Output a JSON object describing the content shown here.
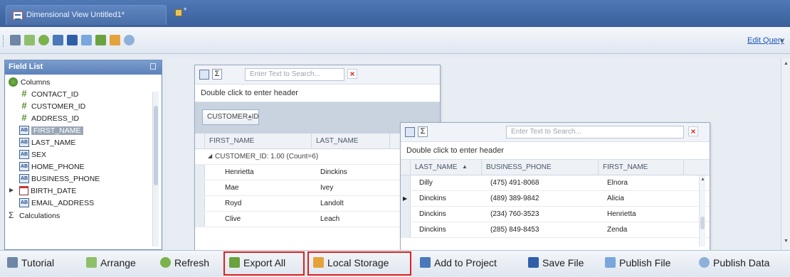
{
  "window": {
    "tab_title": "Dimensional View Untitled1*",
    "new_tab_symbol": "*"
  },
  "toolbar": {
    "edit_query_label": "Edit Query",
    "more_symbol": "▾"
  },
  "field_list": {
    "title": "Field List",
    "columns_label": "Columns",
    "fields": [
      {
        "label": "CONTACT_ID",
        "type": "numeric",
        "icon": "hash-icon"
      },
      {
        "label": "CUSTOMER_ID",
        "type": "numeric",
        "icon": "hash-icon"
      },
      {
        "label": "ADDRESS_ID",
        "type": "numeric",
        "icon": "hash-icon"
      },
      {
        "label": "FIRST_NAME",
        "type": "text",
        "icon": "text-field-icon",
        "selected": true
      },
      {
        "label": "LAST_NAME",
        "type": "text",
        "icon": "text-field-icon"
      },
      {
        "label": "SEX",
        "type": "text",
        "icon": "text-field-icon"
      },
      {
        "label": "HOME_PHONE",
        "type": "text",
        "icon": "text-field-icon"
      },
      {
        "label": "BUSINESS_PHONE",
        "type": "text",
        "icon": "text-field-icon"
      },
      {
        "label": "BIRTH_DATE",
        "type": "date",
        "icon": "calendar-icon"
      },
      {
        "label": "EMAIL_ADDRESS",
        "type": "text",
        "icon": "text-field-icon"
      }
    ],
    "calculations_label": "Calculations"
  },
  "grid1": {
    "search_placeholder": "Enter Text to Search...",
    "header_hint": "Double click to enter header",
    "group_by": "CUSTOMER_ID",
    "columns": [
      "FIRST_NAME",
      "LAST_NAME"
    ],
    "group_row": "CUSTOMER_ID: 1.00 (Count=6)",
    "rows": [
      [
        "Henrietta",
        "Dinckins"
      ],
      [
        "Mae",
        "Ivey"
      ],
      [
        "Royd",
        "Landolt"
      ],
      [
        "Clive",
        "Leach"
      ]
    ]
  },
  "grid2": {
    "search_placeholder": "Enter Text to Search...",
    "header_hint": "Double click to enter header",
    "columns": [
      "LAST_NAME",
      "BUSINESS_PHONE",
      "FIRST_NAME"
    ],
    "rows": [
      [
        "Dilly",
        "(475) 491-8068",
        "Elnora"
      ],
      [
        "Dinckins",
        "(489) 389-9842",
        "Alicia"
      ],
      [
        "Dinckins",
        "(234) 760-3523",
        "Henrietta"
      ],
      [
        "Dinckins",
        "(285) 849-8453",
        "Zenda"
      ]
    ]
  },
  "bottom_bar": {
    "tutorial": "Tutorial",
    "arrange": "Arrange",
    "refresh": "Refresh",
    "export_all": "Export All",
    "local_storage": "Local Storage",
    "add_to_project": "Add to Project",
    "save_file": "Save File",
    "publish_file": "Publish File",
    "publish_data": "Publish Data"
  },
  "colors": {
    "title_bar": "#3f66a3",
    "highlight": "#e0201e",
    "link": "#1f57b5"
  }
}
